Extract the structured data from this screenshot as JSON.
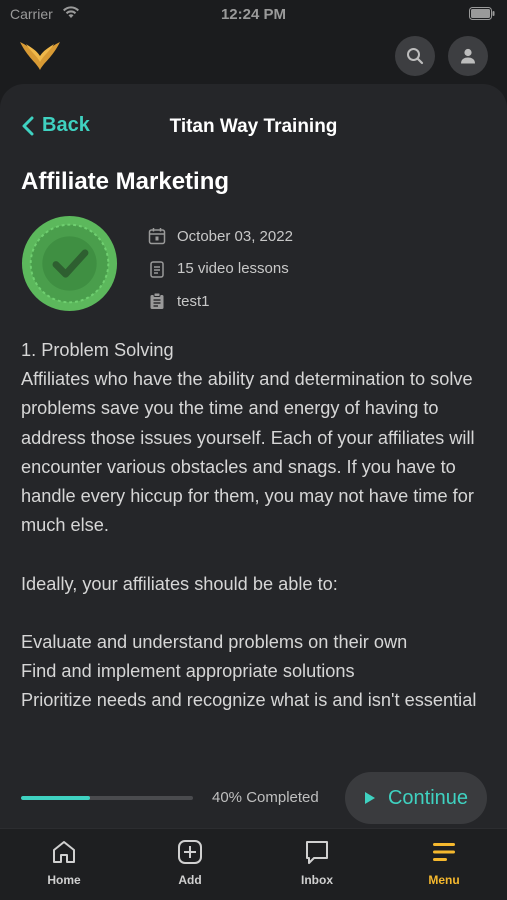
{
  "status_bar": {
    "carrier": "Carrier",
    "time": "12:24 PM"
  },
  "header": {
    "logo": "wings-logo-icon",
    "search_icon": "search-icon",
    "profile_icon": "person-icon"
  },
  "nav": {
    "back_label": "Back",
    "title": "Titan Way Training"
  },
  "course": {
    "title": "Affiliate Marketing",
    "badge_icon": "checkmark-badge-icon",
    "date": "October 03, 2022",
    "lessons": "15 video lessons",
    "author": "test1"
  },
  "content": {
    "heading": "1. Problem Solving",
    "para1": "Affiliates who have the ability and determination to solve problems save you the time and energy of having to address those issues yourself. Each of your affiliates will encounter various obstacles and snags. If you have to handle every hiccup for them, you may not have time for much else.",
    "para2": "Ideally, your affiliates should be able to:",
    "item1": "Evaluate and understand problems on their own",
    "item2": "Find and implement appropriate solutions",
    "item3": "Prioritize needs and recognize what is and isn't essential"
  },
  "progress": {
    "percent": 40,
    "label": "40% Completed",
    "continue_label": "Continue"
  },
  "tabs": [
    {
      "label": "Home",
      "icon": "home-icon"
    },
    {
      "label": "Add",
      "icon": "add-icon"
    },
    {
      "label": "Inbox",
      "icon": "chat-icon"
    },
    {
      "label": "Menu",
      "icon": "menu-icon",
      "active": true
    }
  ],
  "colors": {
    "accent": "#3fd2c1",
    "active_tab": "#f5b82e",
    "badge": "#4caf50"
  }
}
